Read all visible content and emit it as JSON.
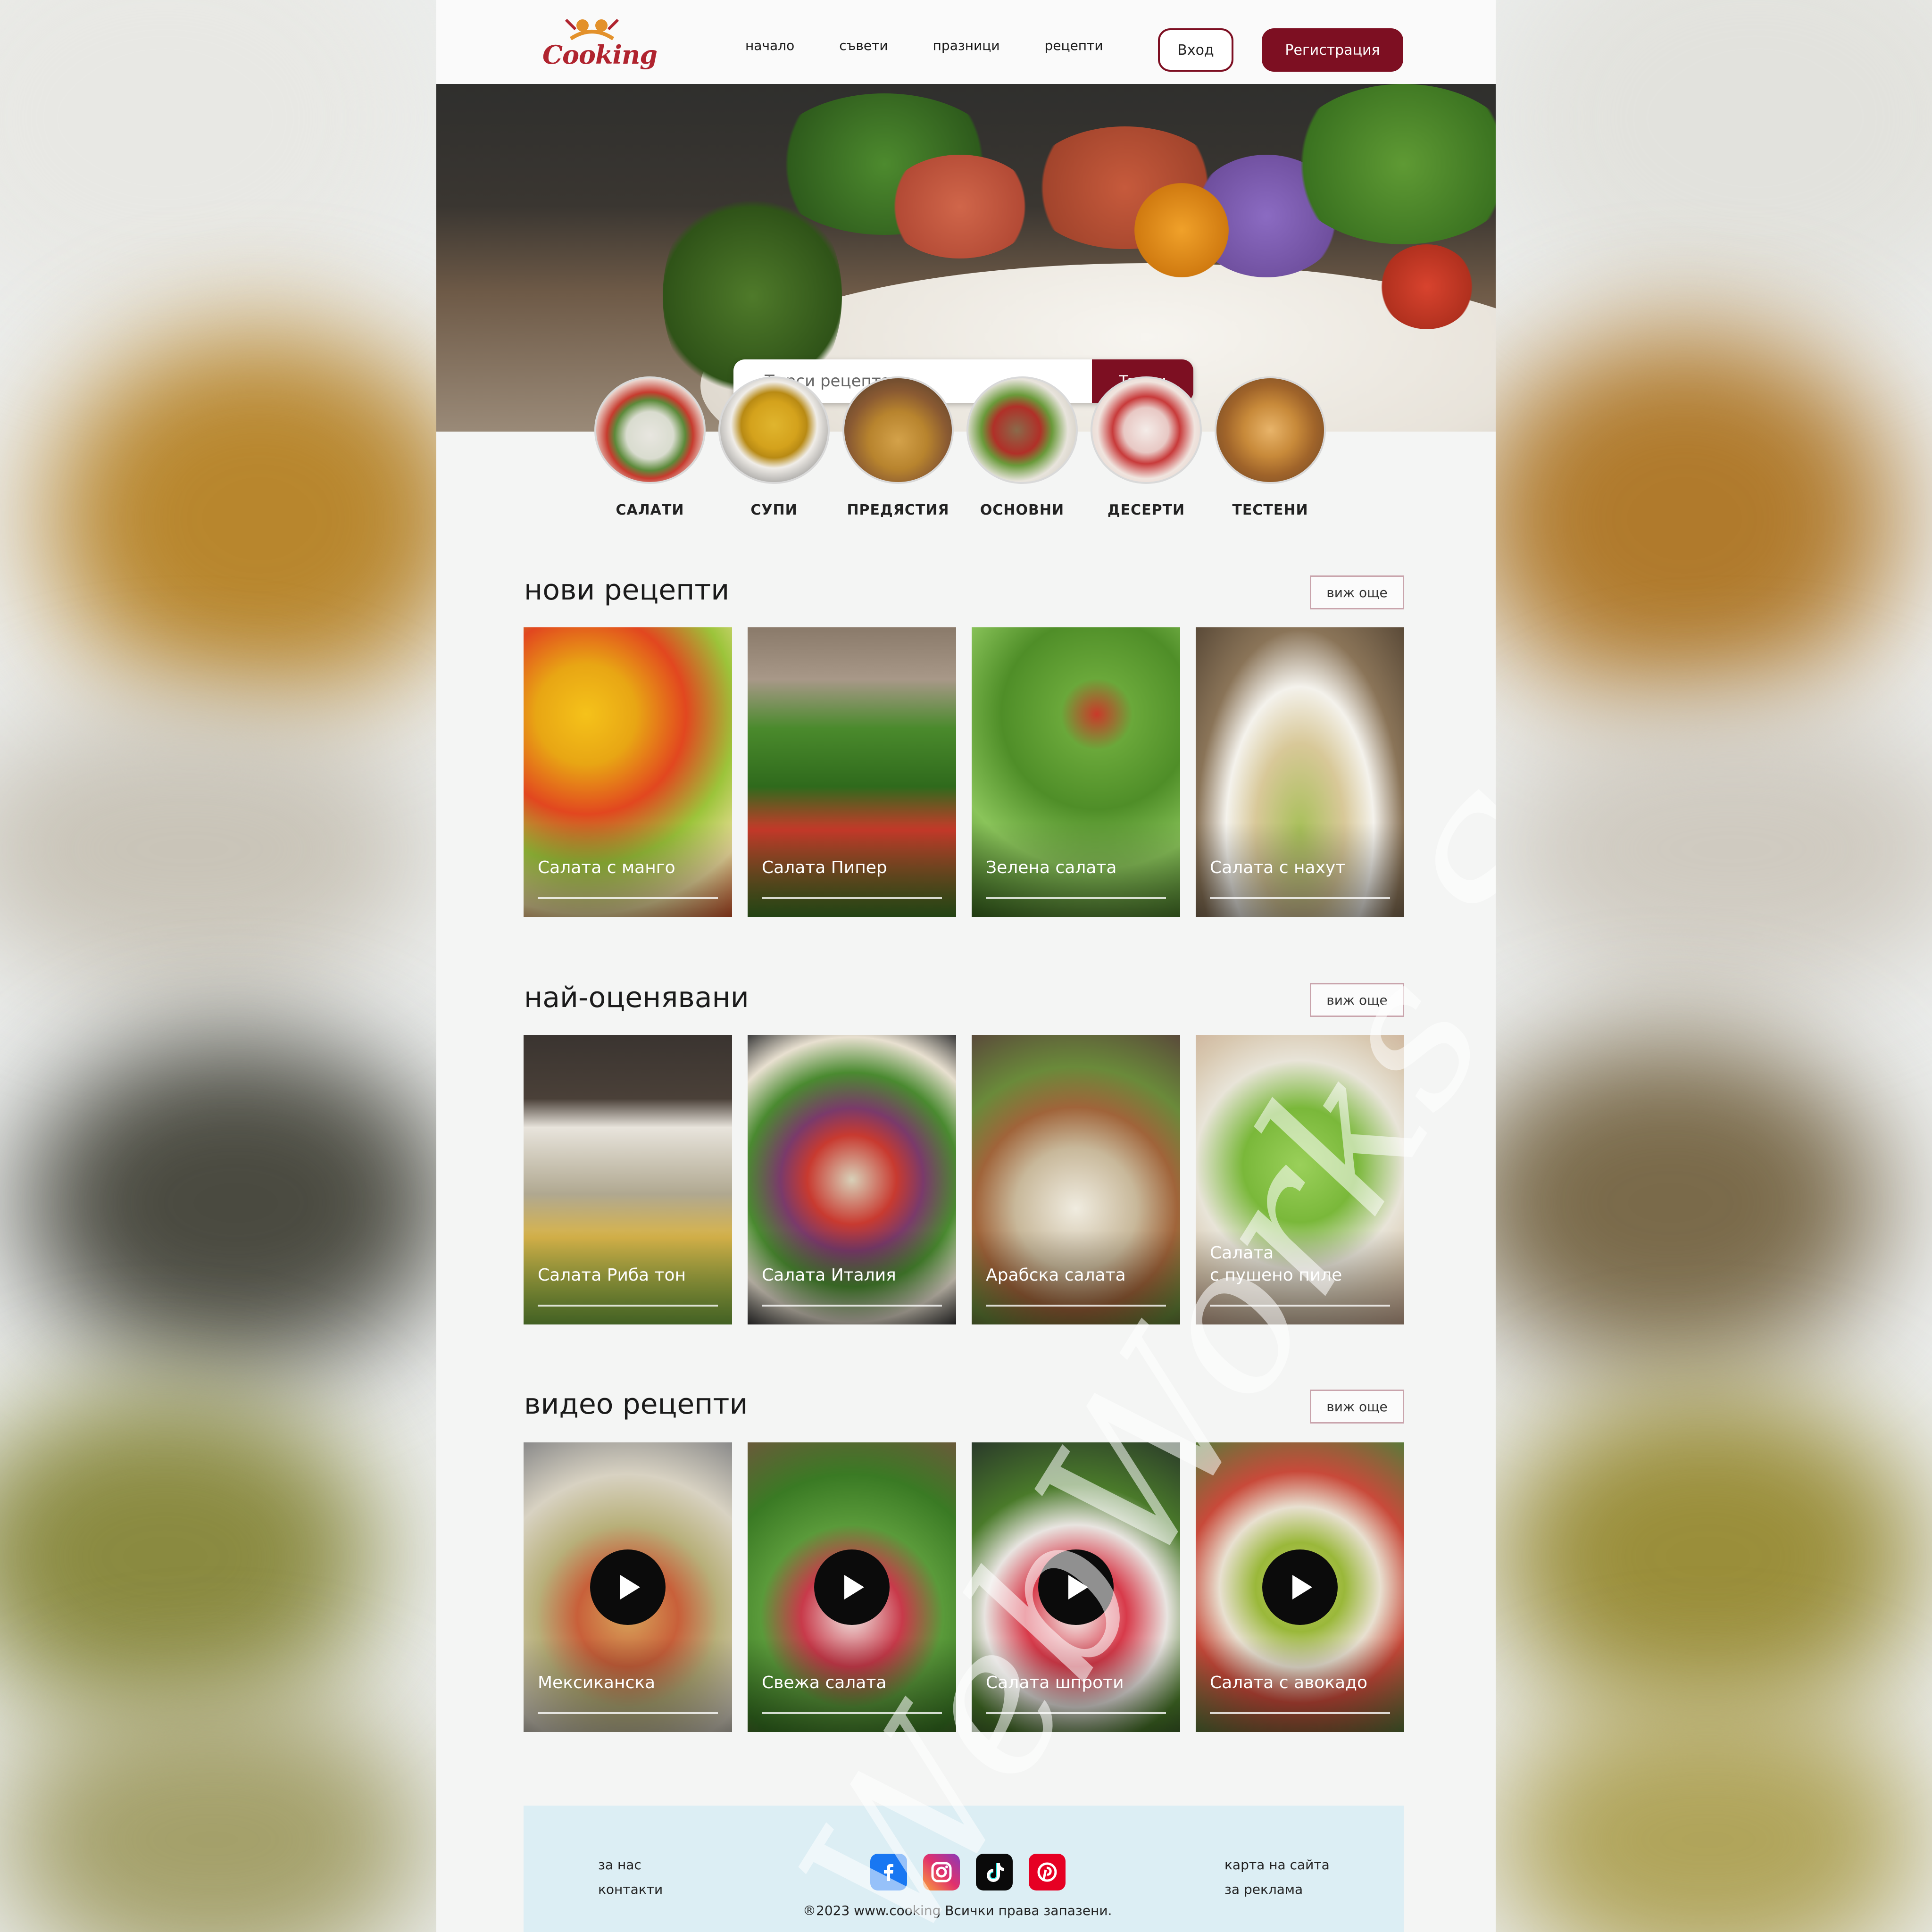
{
  "brand": {
    "logo_text": "Cooking",
    "accent": "#7d0f22"
  },
  "nav": {
    "links": [
      "начало",
      "съвети",
      "празници",
      "рецепти"
    ],
    "login_label": "Вход",
    "register_label": "Регистрация"
  },
  "search": {
    "placeholder": "Търси рецепта",
    "button_label": "Търси"
  },
  "categories": [
    "САЛАТИ",
    "СУПИ",
    "ПРЕДЯСТИЯ",
    "ОСНОВНИ",
    "ДЕСЕРТИ",
    "ТЕСТЕНИ"
  ],
  "sections": [
    {
      "title": "нови рецепти",
      "see_more": "виж още",
      "cards": [
        "Салата с манго",
        "Салата Пипер",
        "Зелена салата",
        "Салата с нахут"
      ]
    },
    {
      "title": "най-оценявани",
      "see_more": "виж още",
      "cards": [
        "Салата Риба тон",
        "Салата Италия",
        "Арабска салата",
        "Салата\nс пушено пиле"
      ]
    },
    {
      "title": "видео рецепти",
      "see_more": "виж още",
      "cards": [
        "Мексиканска",
        "Свежа салата",
        "Салата шпроти",
        "Салата с авокадо"
      ]
    }
  ],
  "footer": {
    "left_links": [
      "за нас",
      "контакти"
    ],
    "right_links": [
      "карта на сайта",
      "за реклама"
    ],
    "socials": [
      "facebook-icon",
      "instagram-icon",
      "tiktok-icon",
      "pinterest-icon"
    ],
    "copyright": "®2023 www.cooking Всички права запазени."
  },
  "watermark": "WebWorks Solutions"
}
